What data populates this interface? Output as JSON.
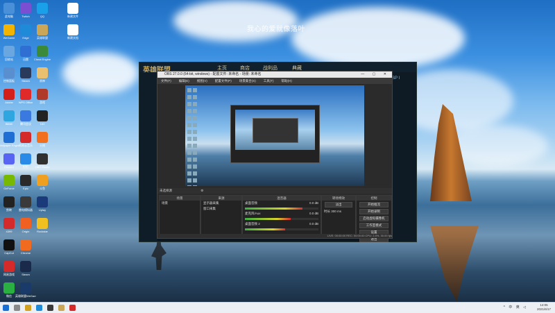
{
  "watermark": "我心的爱就像落叶",
  "desktop_icons": [
    {
      "label": "此电脑",
      "color": "#4a90d9",
      "col": 0,
      "row": 0
    },
    {
      "label": "Twitch",
      "color": "#7b4fd1",
      "col": 1,
      "row": 0
    },
    {
      "label": "QQ",
      "color": "#1aa0e8",
      "col": 2,
      "row": 0
    },
    {
      "label": "新建文件",
      "color": "#ffffff",
      "col": 3,
      "row": 0
    },
    {
      "label": "WeGame",
      "color": "#f2b400",
      "col": 0,
      "row": 1
    },
    {
      "label": "Edge",
      "color": "#1f8ad8",
      "col": 1,
      "row": 1
    },
    {
      "label": "英雄联盟",
      "color": "#c9a658",
      "col": 2,
      "row": 1
    },
    {
      "label": "新建文档",
      "color": "#ffffff",
      "col": 3,
      "row": 1
    },
    {
      "label": "回收站",
      "color": "#6aa6e0",
      "col": 0,
      "row": 2
    },
    {
      "label": "迅雷",
      "color": "#2f6fd4",
      "col": 1,
      "row": 2
    },
    {
      "label": "Cheat Engine",
      "color": "#3a8a3a",
      "col": 2,
      "row": 2
    },
    {
      "label": "控制面板",
      "color": "#5a8fcf",
      "col": 0,
      "row": 3
    },
    {
      "label": "Steam",
      "color": "#2a3a5a",
      "col": 1,
      "row": 3
    },
    {
      "label": "原神",
      "color": "#e8c070",
      "col": 2,
      "row": 3
    },
    {
      "label": "Adobe",
      "color": "#d4201a",
      "col": 0,
      "row": 4
    },
    {
      "label": "WPS Office",
      "color": "#e02a2a",
      "col": 1,
      "row": 4
    },
    {
      "label": "游戏",
      "color": "#b03a2a",
      "col": 2,
      "row": 4
    },
    {
      "label": "Bilibili",
      "color": "#2fa6e0",
      "col": 0,
      "row": 5
    },
    {
      "label": "腾讯会议",
      "color": "#3a7ae0",
      "col": 1,
      "row": 5
    },
    {
      "label": "163",
      "color": "#222222",
      "col": 2,
      "row": 5
    },
    {
      "label": "Wallpaper Engine",
      "color": "#1f6ed4",
      "col": 0,
      "row": 6
    },
    {
      "label": "网易云音乐",
      "color": "#d42a2a",
      "col": 1,
      "row": 6
    },
    {
      "label": "火绒",
      "color": "#f07020",
      "col": 2,
      "row": 6
    },
    {
      "label": "Discord",
      "color": "#5865f2",
      "col": 0,
      "row": 7
    },
    {
      "label": "钉钉",
      "color": "#2a8ae8",
      "col": 1,
      "row": 7
    },
    {
      "label": "OBS Studio",
      "color": "#303030",
      "col": 2,
      "row": 7
    },
    {
      "label": "GeForce",
      "color": "#76b900",
      "col": 0,
      "row": 8
    },
    {
      "label": "Epic",
      "color": "#2a2a2a",
      "col": 1,
      "row": 8
    },
    {
      "label": "斗鱼",
      "color": "#f0a020",
      "col": 2,
      "row": 8
    },
    {
      "label": "剪映",
      "color": "#222222",
      "col": 0,
      "row": 9
    },
    {
      "label": "雷电模拟器",
      "color": "#3a3a3a",
      "col": 1,
      "row": 9
    },
    {
      "label": "Uplay",
      "color": "#1a3a7a",
      "col": 2,
      "row": 9
    },
    {
      "label": "4399",
      "color": "#d42a2a",
      "col": 0,
      "row": 10
    },
    {
      "label": "Origin",
      "color": "#f06020",
      "col": 1,
      "row": 10
    },
    {
      "label": "Rockstar",
      "color": "#f0c020",
      "col": 2,
      "row": 10
    },
    {
      "label": "CapCut",
      "color": "#111111",
      "col": 0,
      "row": 11
    },
    {
      "label": "Chrome",
      "color": "#f06a20",
      "col": 1,
      "row": 11
    },
    {
      "label": "网易游戏",
      "color": "#d42a2a",
      "col": 0,
      "row": 12
    },
    {
      "label": "Steam",
      "color": "#1a2a4a",
      "col": 1,
      "row": 12
    },
    {
      "label": "微信",
      "color": "#2ab040",
      "col": 0,
      "row": 13
    },
    {
      "label": "英雄联盟WeGame版",
      "color": "#1a3a6a",
      "col": 1,
      "row": 13
    }
  ],
  "lol": {
    "logo": "英雄联盟",
    "tabs": [
      "主页",
      "商店",
      "战利品",
      "典藏"
    ],
    "right_label": "SP I"
  },
  "obs": {
    "title": "OBS 27.0.0 (64-bit, windows) - 配置文件: 未命名 - 场景: 未命名",
    "menu": [
      "文件(F)",
      "编辑(E)",
      "视图(V)",
      "配置文件(P)",
      "场景集合(S)",
      "工具(T)",
      "帮助(H)"
    ],
    "scene_bar": "未选择源",
    "scenes_header": "场景",
    "scenes": [
      "场景"
    ],
    "sources_header": "来源",
    "sources": [
      "显示器采集",
      "窗口采集"
    ],
    "mixer_header": "混音器",
    "mixer": [
      {
        "name": "桌面音频",
        "db": "0.0 dB",
        "level": 0.78
      },
      {
        "name": "麦克风/Aux",
        "db": "0.0 dB",
        "level": 0.62
      },
      {
        "name": "桌面音频 2",
        "db": "0.0 dB",
        "level": 0.55
      }
    ],
    "transitions_header": "转场特效",
    "transition": "淡出",
    "duration_label": "时长",
    "duration": "300 ms",
    "controls_header": "控制",
    "controls": [
      "开始推流",
      "开始录制",
      "启动虚拟摄像机",
      "工作室模式",
      "设置",
      "退出"
    ],
    "status": "LIVE: 00:00:00  REC: 00:00:00  CPU: 2.4%, 30.00 fps"
  },
  "tray": "^ 中 英 ◁ ",
  "clock_time": "14:05",
  "clock_date": "2021/6/17"
}
